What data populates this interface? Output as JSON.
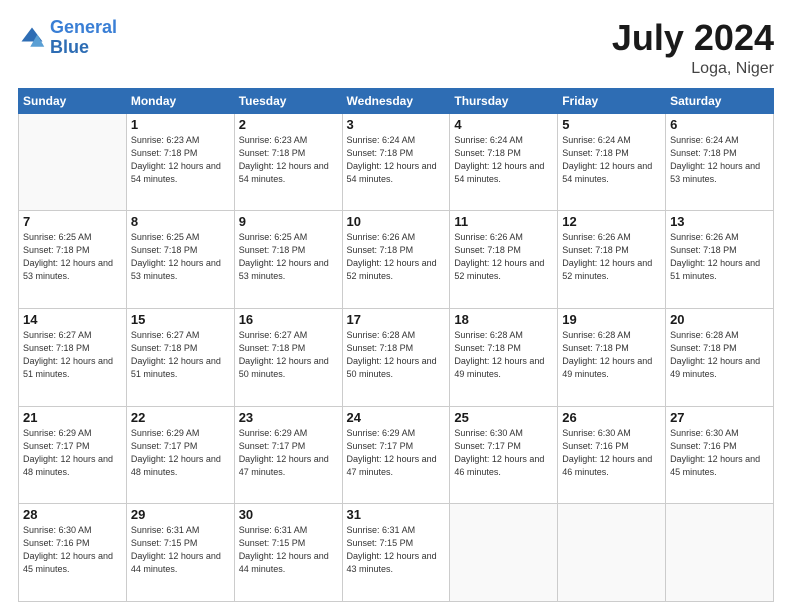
{
  "header": {
    "logo_line1": "General",
    "logo_line2": "Blue",
    "month_title": "July 2024",
    "location": "Loga, Niger"
  },
  "weekdays": [
    "Sunday",
    "Monday",
    "Tuesday",
    "Wednesday",
    "Thursday",
    "Friday",
    "Saturday"
  ],
  "weeks": [
    [
      {
        "day": "",
        "sunrise": "",
        "sunset": "",
        "daylight": ""
      },
      {
        "day": "1",
        "sunrise": "Sunrise: 6:23 AM",
        "sunset": "Sunset: 7:18 PM",
        "daylight": "Daylight: 12 hours and 54 minutes."
      },
      {
        "day": "2",
        "sunrise": "Sunrise: 6:23 AM",
        "sunset": "Sunset: 7:18 PM",
        "daylight": "Daylight: 12 hours and 54 minutes."
      },
      {
        "day": "3",
        "sunrise": "Sunrise: 6:24 AM",
        "sunset": "Sunset: 7:18 PM",
        "daylight": "Daylight: 12 hours and 54 minutes."
      },
      {
        "day": "4",
        "sunrise": "Sunrise: 6:24 AM",
        "sunset": "Sunset: 7:18 PM",
        "daylight": "Daylight: 12 hours and 54 minutes."
      },
      {
        "day": "5",
        "sunrise": "Sunrise: 6:24 AM",
        "sunset": "Sunset: 7:18 PM",
        "daylight": "Daylight: 12 hours and 54 minutes."
      },
      {
        "day": "6",
        "sunrise": "Sunrise: 6:24 AM",
        "sunset": "Sunset: 7:18 PM",
        "daylight": "Daylight: 12 hours and 53 minutes."
      }
    ],
    [
      {
        "day": "7",
        "sunrise": "Sunrise: 6:25 AM",
        "sunset": "Sunset: 7:18 PM",
        "daylight": "Daylight: 12 hours and 53 minutes."
      },
      {
        "day": "8",
        "sunrise": "Sunrise: 6:25 AM",
        "sunset": "Sunset: 7:18 PM",
        "daylight": "Daylight: 12 hours and 53 minutes."
      },
      {
        "day": "9",
        "sunrise": "Sunrise: 6:25 AM",
        "sunset": "Sunset: 7:18 PM",
        "daylight": "Daylight: 12 hours and 53 minutes."
      },
      {
        "day": "10",
        "sunrise": "Sunrise: 6:26 AM",
        "sunset": "Sunset: 7:18 PM",
        "daylight": "Daylight: 12 hours and 52 minutes."
      },
      {
        "day": "11",
        "sunrise": "Sunrise: 6:26 AM",
        "sunset": "Sunset: 7:18 PM",
        "daylight": "Daylight: 12 hours and 52 minutes."
      },
      {
        "day": "12",
        "sunrise": "Sunrise: 6:26 AM",
        "sunset": "Sunset: 7:18 PM",
        "daylight": "Daylight: 12 hours and 52 minutes."
      },
      {
        "day": "13",
        "sunrise": "Sunrise: 6:26 AM",
        "sunset": "Sunset: 7:18 PM",
        "daylight": "Daylight: 12 hours and 51 minutes."
      }
    ],
    [
      {
        "day": "14",
        "sunrise": "Sunrise: 6:27 AM",
        "sunset": "Sunset: 7:18 PM",
        "daylight": "Daylight: 12 hours and 51 minutes."
      },
      {
        "day": "15",
        "sunrise": "Sunrise: 6:27 AM",
        "sunset": "Sunset: 7:18 PM",
        "daylight": "Daylight: 12 hours and 51 minutes."
      },
      {
        "day": "16",
        "sunrise": "Sunrise: 6:27 AM",
        "sunset": "Sunset: 7:18 PM",
        "daylight": "Daylight: 12 hours and 50 minutes."
      },
      {
        "day": "17",
        "sunrise": "Sunrise: 6:28 AM",
        "sunset": "Sunset: 7:18 PM",
        "daylight": "Daylight: 12 hours and 50 minutes."
      },
      {
        "day": "18",
        "sunrise": "Sunrise: 6:28 AM",
        "sunset": "Sunset: 7:18 PM",
        "daylight": "Daylight: 12 hours and 49 minutes."
      },
      {
        "day": "19",
        "sunrise": "Sunrise: 6:28 AM",
        "sunset": "Sunset: 7:18 PM",
        "daylight": "Daylight: 12 hours and 49 minutes."
      },
      {
        "day": "20",
        "sunrise": "Sunrise: 6:28 AM",
        "sunset": "Sunset: 7:18 PM",
        "daylight": "Daylight: 12 hours and 49 minutes."
      }
    ],
    [
      {
        "day": "21",
        "sunrise": "Sunrise: 6:29 AM",
        "sunset": "Sunset: 7:17 PM",
        "daylight": "Daylight: 12 hours and 48 minutes."
      },
      {
        "day": "22",
        "sunrise": "Sunrise: 6:29 AM",
        "sunset": "Sunset: 7:17 PM",
        "daylight": "Daylight: 12 hours and 48 minutes."
      },
      {
        "day": "23",
        "sunrise": "Sunrise: 6:29 AM",
        "sunset": "Sunset: 7:17 PM",
        "daylight": "Daylight: 12 hours and 47 minutes."
      },
      {
        "day": "24",
        "sunrise": "Sunrise: 6:29 AM",
        "sunset": "Sunset: 7:17 PM",
        "daylight": "Daylight: 12 hours and 47 minutes."
      },
      {
        "day": "25",
        "sunrise": "Sunrise: 6:30 AM",
        "sunset": "Sunset: 7:17 PM",
        "daylight": "Daylight: 12 hours and 46 minutes."
      },
      {
        "day": "26",
        "sunrise": "Sunrise: 6:30 AM",
        "sunset": "Sunset: 7:16 PM",
        "daylight": "Daylight: 12 hours and 46 minutes."
      },
      {
        "day": "27",
        "sunrise": "Sunrise: 6:30 AM",
        "sunset": "Sunset: 7:16 PM",
        "daylight": "Daylight: 12 hours and 45 minutes."
      }
    ],
    [
      {
        "day": "28",
        "sunrise": "Sunrise: 6:30 AM",
        "sunset": "Sunset: 7:16 PM",
        "daylight": "Daylight: 12 hours and 45 minutes."
      },
      {
        "day": "29",
        "sunrise": "Sunrise: 6:31 AM",
        "sunset": "Sunset: 7:15 PM",
        "daylight": "Daylight: 12 hours and 44 minutes."
      },
      {
        "day": "30",
        "sunrise": "Sunrise: 6:31 AM",
        "sunset": "Sunset: 7:15 PM",
        "daylight": "Daylight: 12 hours and 44 minutes."
      },
      {
        "day": "31",
        "sunrise": "Sunrise: 6:31 AM",
        "sunset": "Sunset: 7:15 PM",
        "daylight": "Daylight: 12 hours and 43 minutes."
      },
      {
        "day": "",
        "sunrise": "",
        "sunset": "",
        "daylight": ""
      },
      {
        "day": "",
        "sunrise": "",
        "sunset": "",
        "daylight": ""
      },
      {
        "day": "",
        "sunrise": "",
        "sunset": "",
        "daylight": ""
      }
    ]
  ]
}
